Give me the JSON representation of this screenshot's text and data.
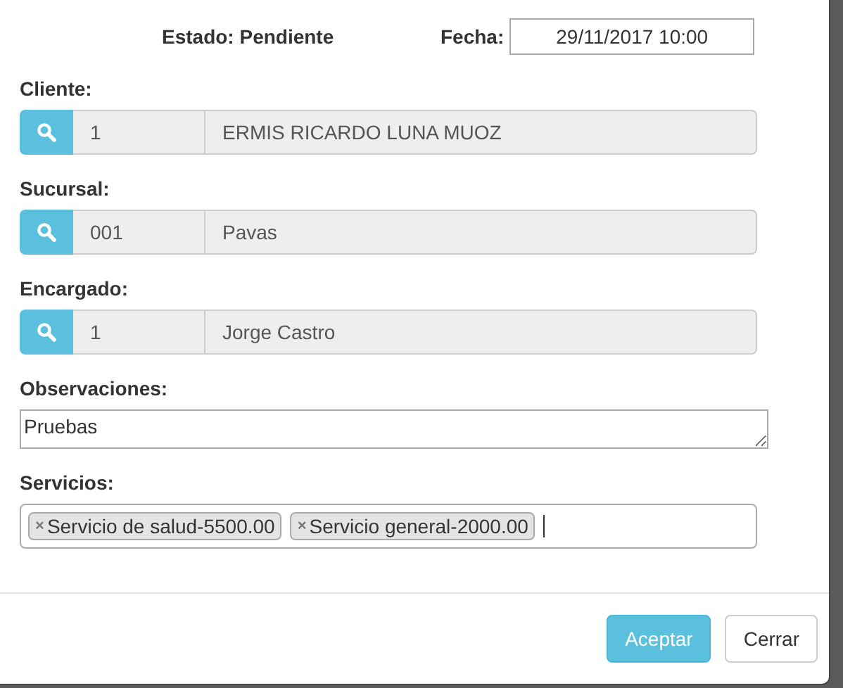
{
  "estado": "Estado: Pendiente",
  "fecha": {
    "label": "Fecha:",
    "value": "29/11/2017 10:00"
  },
  "lookups": [
    {
      "label": "Cliente:",
      "code": "1",
      "name": "ERMIS RICARDO LUNA MUOZ"
    },
    {
      "label": "Sucursal:",
      "code": "001",
      "name": "Pavas"
    },
    {
      "label": "Encargado:",
      "code": "1",
      "name": "Jorge Castro"
    }
  ],
  "observaciones": {
    "label": "Observaciones:",
    "value": "Pruebas"
  },
  "servicios": {
    "label": "Servicios:",
    "remove_symbol": "×",
    "tags": [
      "Servicio de salud-5500.00",
      "Servicio general-2000.00"
    ]
  },
  "buttons": [
    {
      "label": "Aceptar",
      "kind": "primary"
    },
    {
      "label": "Cerrar",
      "kind": "default"
    }
  ]
}
